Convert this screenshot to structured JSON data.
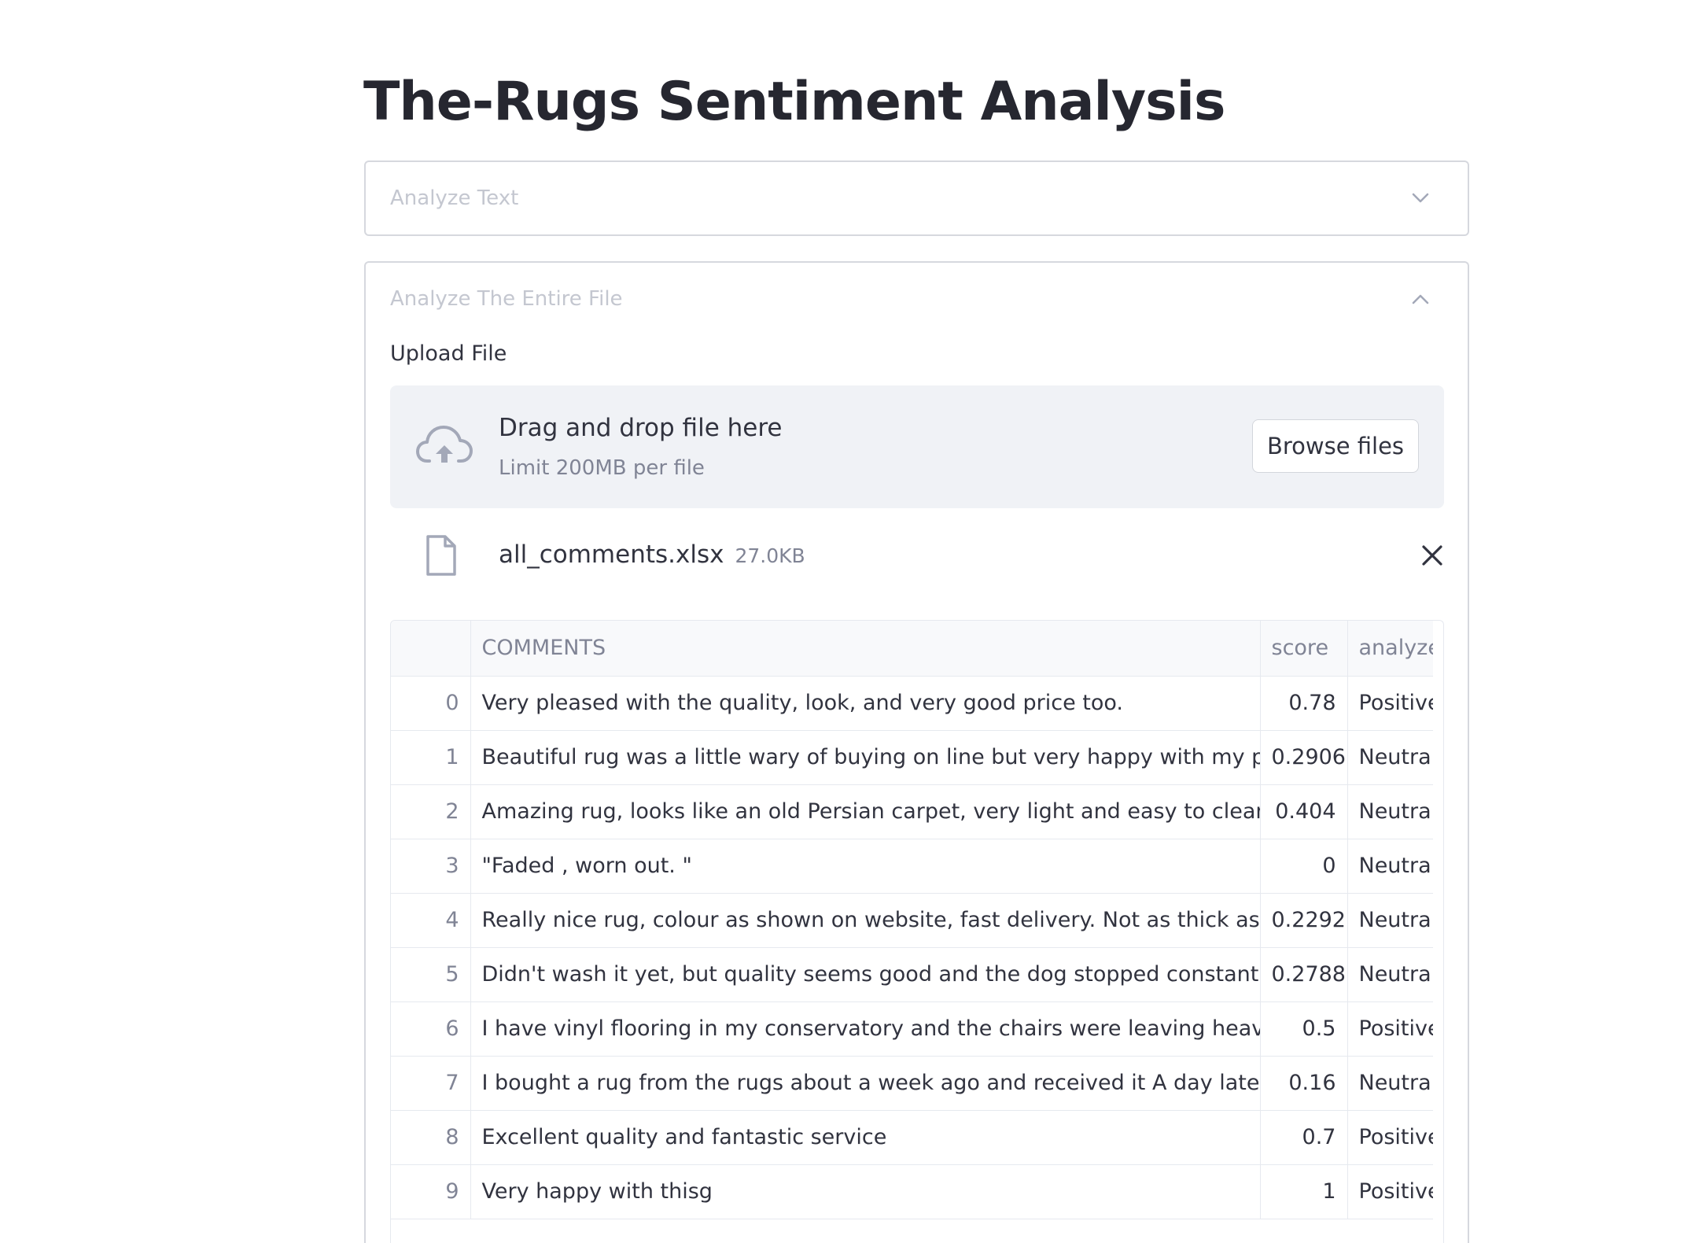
{
  "page": {
    "title": "The-Rugs Sentiment Analysis"
  },
  "expander_text": {
    "label": "Analyze Text",
    "icon": "chevron-down-icon"
  },
  "expander_file": {
    "label": "Analyze The Entire File",
    "icon": "chevron-up-icon",
    "upload_label": "Upload File",
    "dropzone": {
      "title": "Drag and drop file here",
      "subtitle": "Limit 200MB per file",
      "browse_label": "Browse files",
      "icon": "cloud-upload-icon"
    },
    "uploaded_file": {
      "name": "all_comments.xlsx",
      "size": "27.0KB",
      "icon": "file-icon",
      "remove_icon": "close-icon"
    },
    "table": {
      "columns": [
        "",
        "COMMENTS",
        "score",
        "analyze"
      ],
      "rows": [
        {
          "index": "0",
          "comment": "Very pleased with the quality, look, and very good price too.",
          "score": "0.78",
          "analyze": "Positive"
        },
        {
          "index": "1",
          "comment": "Beautiful rug was a little wary of buying on line but very happy with my purchase",
          "score": "0.2906",
          "analyze": "Neutral"
        },
        {
          "index": "2",
          "comment": "Amazing rug, looks like an old Persian carpet, very light and easy to clean.",
          "score": "0.404",
          "analyze": "Neutral"
        },
        {
          "index": "3",
          "comment": "\"Faded , worn out. \"",
          "score": "0",
          "analyze": "Neutral"
        },
        {
          "index": "4",
          "comment": "Really nice rug, colour as shown on website, fast delivery. Not as thick as some Iâv",
          "score": "0.2292",
          "analyze": "Neutral"
        },
        {
          "index": "5",
          "comment": "Didn't wash it yet,  but quality seems good and the dog stopped constantly going ups",
          "score": "0.2788",
          "analyze": "Neutral"
        },
        {
          "index": "6",
          "comment": "I have vinyl flooring in my conservatory and the chairs were leaving heavy indentation",
          "score": "0.5",
          "analyze": "Positive"
        },
        {
          "index": "7",
          "comment": "I bought a rug from the rugs about a week ago and received it A day later the rug cam",
          "score": "0.16",
          "analyze": "Neutral"
        },
        {
          "index": "8",
          "comment": "Excellent quality and fantastic service",
          "score": "0.7",
          "analyze": "Positive"
        },
        {
          "index": "9",
          "comment": "Very happy with thisg",
          "score": "1",
          "analyze": "Positive"
        }
      ]
    }
  },
  "colors": {
    "title": "#262730",
    "muted_label": "#c4c7d0",
    "dropzone_bg": "#f0f2f6",
    "icon": "#a3a8b8"
  }
}
